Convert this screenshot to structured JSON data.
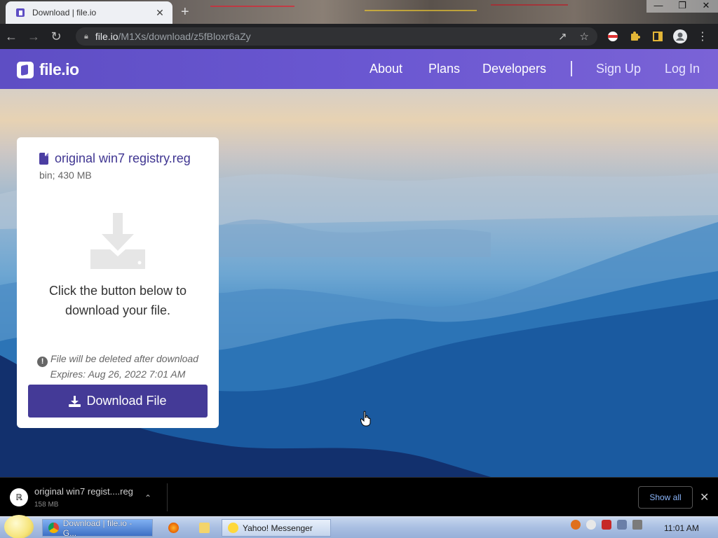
{
  "browser": {
    "tab_title": "Download | file.io",
    "tab_close": "✕",
    "new_tab": "+",
    "url_host": "file.io",
    "url_path": "/M1Xs/download/z5fBloxr6aZy",
    "window_controls": [
      "—",
      "❐",
      "✕"
    ]
  },
  "site": {
    "logo_text": "file.io",
    "nav": {
      "about": "About",
      "plans": "Plans",
      "developers": "Developers",
      "signup": "Sign Up",
      "login": "Log In"
    },
    "accent_color": "#5e4ec4"
  },
  "card": {
    "file_name": "original win7 registry.reg",
    "file_meta": "bin; 430 MB",
    "instruction": "Click the button below to download your file.",
    "delete_notice": "File will be deleted after download",
    "expires": "Expires: Aug 26, 2022 7:01 AM",
    "download_label": "Download File",
    "button_color": "#443a97"
  },
  "download_shelf": {
    "item_name": "original win7 regist....reg",
    "item_size": "158 MB",
    "show_all": "Show all",
    "close": "✕"
  },
  "taskbar": {
    "chrome_button": "Download | file.io - G...",
    "messenger_button": "Yahoo! Messenger",
    "clock": "11:01 AM"
  }
}
